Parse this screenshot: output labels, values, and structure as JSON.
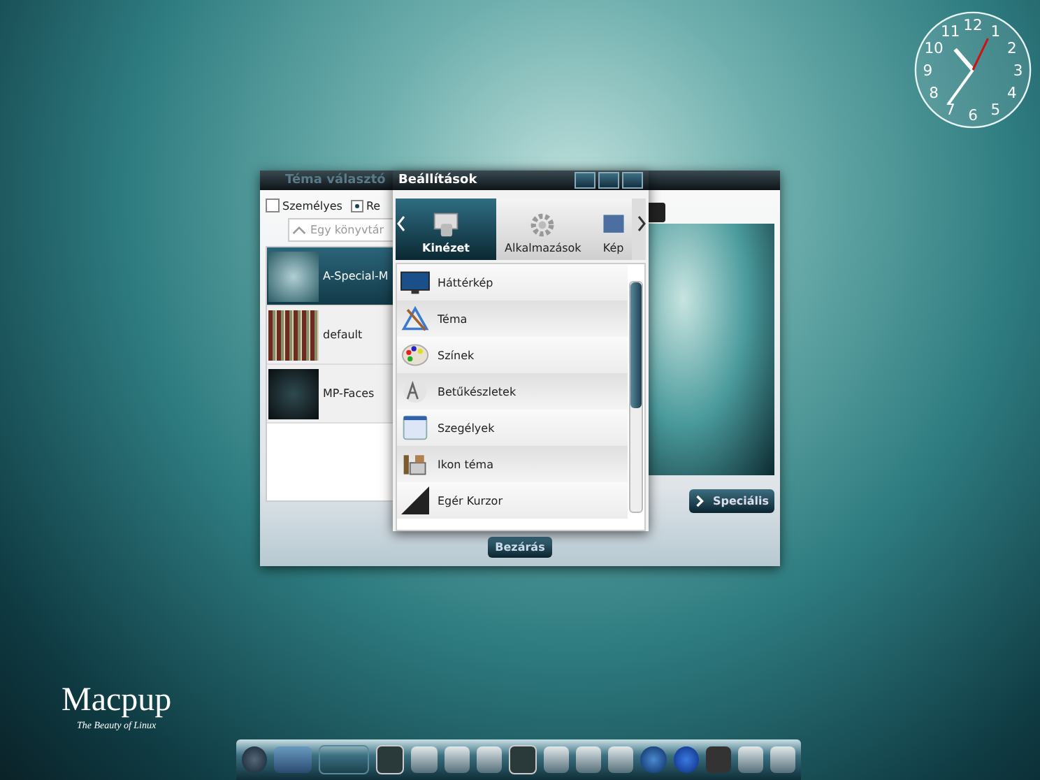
{
  "clock": {
    "numerals": [
      "11",
      "12",
      "1",
      "10",
      "2",
      "9",
      "3",
      "8",
      "4",
      "7",
      "6",
      "5"
    ]
  },
  "theme_window": {
    "title": "Téma választó",
    "personal": {
      "label": "Személyes",
      "checked": false
    },
    "system": {
      "label": "Re",
      "selected": true
    },
    "folder_field": {
      "placeholder": "Egy könyvtár"
    },
    "themes": [
      {
        "name": "A-Special-M",
        "selected": true
      },
      {
        "name": "default",
        "selected": false
      },
      {
        "name": "MP-Faces",
        "selected": false
      }
    ],
    "special_button": "Speciális",
    "close_button": "Bezárás"
  },
  "settings_window": {
    "title": "Beállítások",
    "tabs": [
      {
        "label": "Kinézet",
        "selected": true
      },
      {
        "label": "Alkalmazások",
        "selected": false
      },
      {
        "label": "Kép",
        "selected": false
      }
    ],
    "items": [
      {
        "label": "Háttérkép",
        "kind": "wallpaper"
      },
      {
        "label": "Téma",
        "kind": "theme"
      },
      {
        "label": "Színek",
        "kind": "colors"
      },
      {
        "label": "Betűkészletek",
        "kind": "fonts"
      },
      {
        "label": "Szegélyek",
        "kind": "borders"
      },
      {
        "label": "Ikon téma",
        "kind": "icons"
      },
      {
        "label": "Egér Kurzor",
        "kind": "cursor"
      }
    ]
  },
  "logo": {
    "name": "Macpup",
    "tagline": "The Beauty of Linux"
  }
}
